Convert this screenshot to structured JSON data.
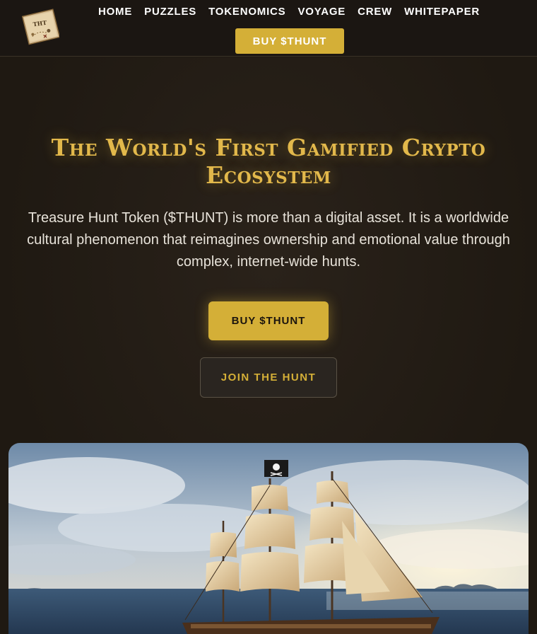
{
  "nav": {
    "logo_text": "THT",
    "links": [
      "HOME",
      "PUZZLES",
      "TOKENOMICS",
      "VOYAGE",
      "CREW",
      "WHITEPAPER"
    ],
    "buy_label": "BUY $THUNT"
  },
  "hero": {
    "title": "The World's First Gamified Crypto Ecosystem",
    "description": "Treasure Hunt Token ($THUNT) is more than a digital asset. It is a worldwide cultural phenomenon that reimagines ownership and emotional value through complex, internet-wide hunts.",
    "primary_button": "BUY $THUNT",
    "secondary_button": "JOIN THE HUNT"
  },
  "colors": {
    "accent": "#d4af37",
    "background": "#1f1912",
    "title": "#e2b84b"
  },
  "icons": [
    "treasure-map-logo-icon",
    "jolly-roger-flag-icon"
  ]
}
